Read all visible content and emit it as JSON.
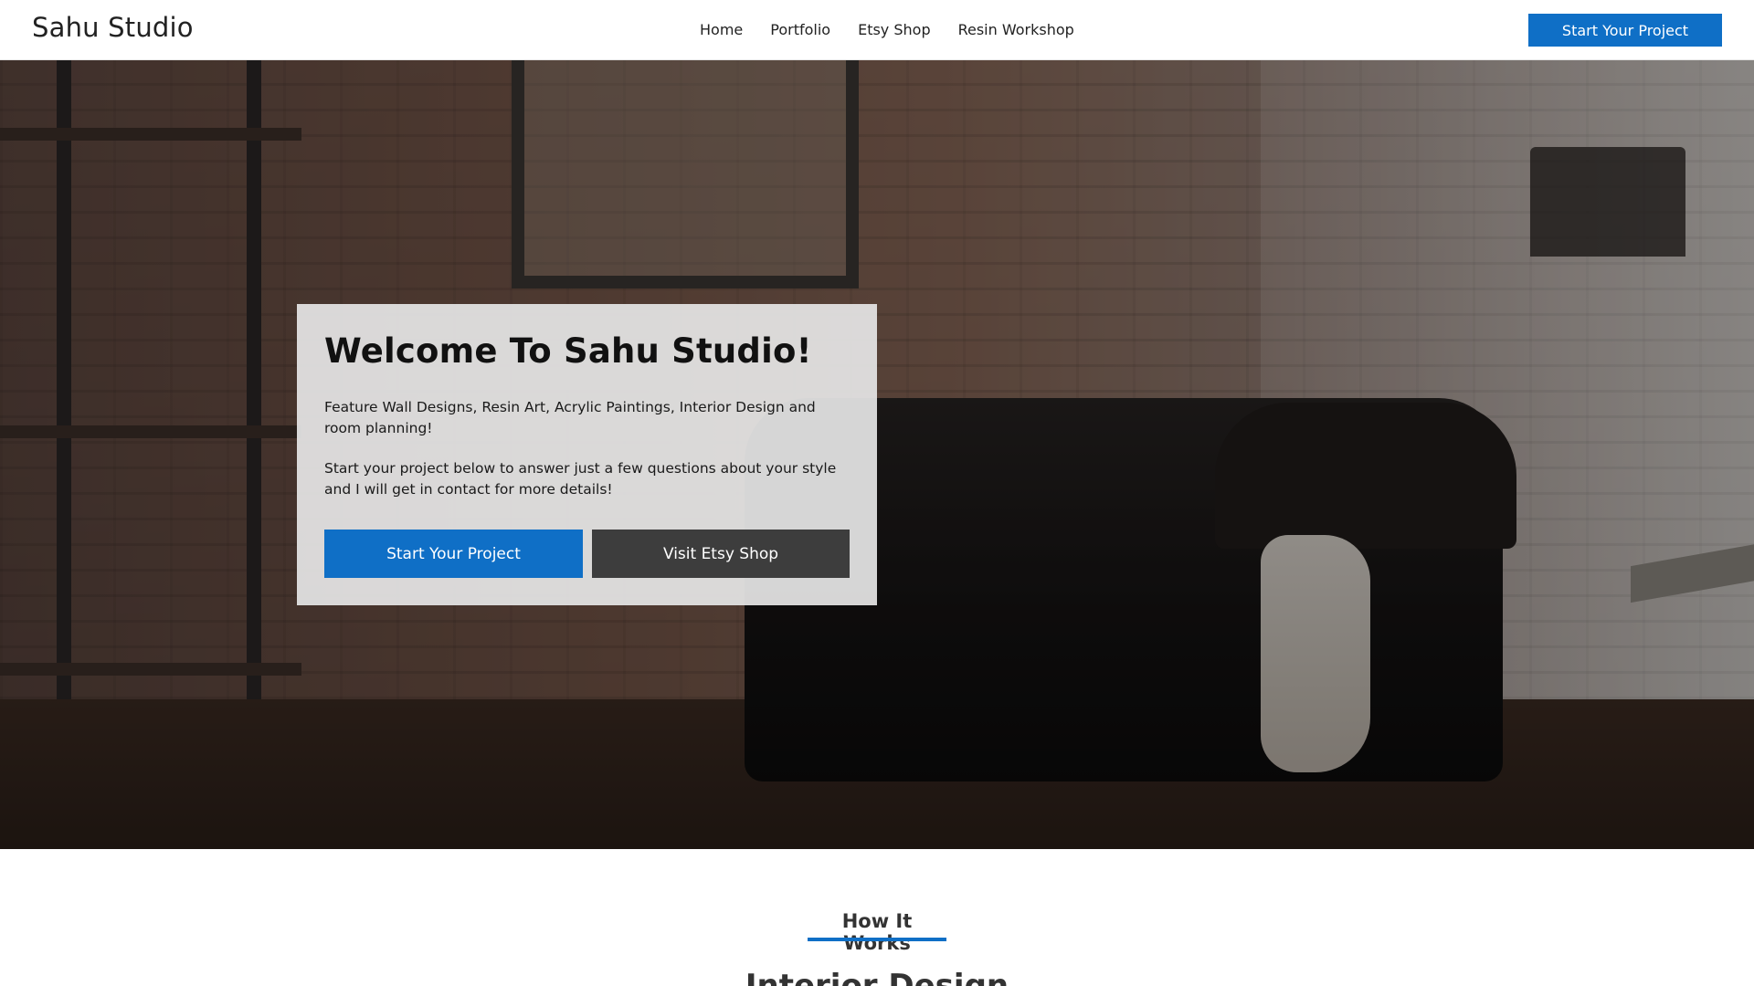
{
  "header": {
    "logo": "Sahu Studio",
    "nav": [
      "Home",
      "Portfolio",
      "Etsy Shop",
      "Resin Workshop"
    ],
    "cta": "Start Your Project"
  },
  "hero": {
    "title": "Welcome To Sahu Studio!",
    "paragraph1": "Feature Wall Designs, Resin Art, Acrylic Paintings, Interior Design and room planning!",
    "paragraph2": "Start your project below to answer just a few questions about your style and I will get in contact for more details!",
    "primary_button": "Start Your Project",
    "secondary_button": "Visit Etsy Shop"
  },
  "section": {
    "tag": "How It Works",
    "heading": "Interior Design"
  },
  "colors": {
    "accent": "#0f6fc6",
    "secondary_button": "#3d3d3d",
    "card_bg": "#e5e5e5"
  }
}
